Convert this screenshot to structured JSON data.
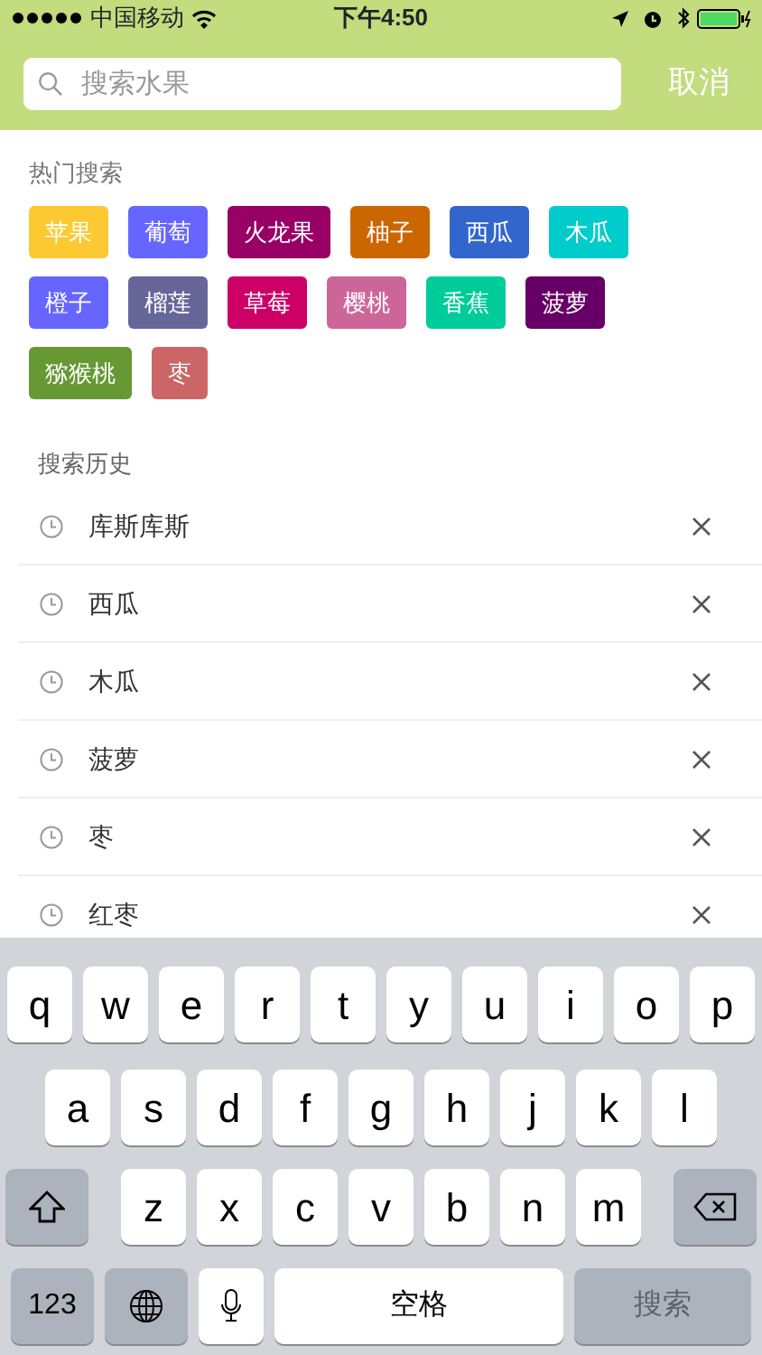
{
  "status_bar": {
    "carrier": "中国移动",
    "time": "下午4:50"
  },
  "search": {
    "placeholder": "搜索水果",
    "cancel": "取消"
  },
  "hot": {
    "title": "热门搜索",
    "tags": [
      {
        "label": "苹果",
        "color": "#fdc932"
      },
      {
        "label": "葡萄",
        "color": "#6666ff"
      },
      {
        "label": "火龙果",
        "color": "#990066"
      },
      {
        "label": "柚子",
        "color": "#cc6600"
      },
      {
        "label": "西瓜",
        "color": "#3366cc"
      },
      {
        "label": "木瓜",
        "color": "#00cccc"
      },
      {
        "label": "橙子",
        "color": "#6666ff"
      },
      {
        "label": "榴莲",
        "color": "#666699"
      },
      {
        "label": "草莓",
        "color": "#cc0066"
      },
      {
        "label": "樱桃",
        "color": "#cc6699"
      },
      {
        "label": "香蕉",
        "color": "#00cc99"
      },
      {
        "label": "菠萝",
        "color": "#660066"
      },
      {
        "label": "猕猴桃",
        "color": "#669933"
      },
      {
        "label": "枣",
        "color": "#cc6666"
      }
    ]
  },
  "history": {
    "title": "搜索历史",
    "items": [
      {
        "label": "库斯库斯"
      },
      {
        "label": "西瓜"
      },
      {
        "label": "木瓜"
      },
      {
        "label": "菠萝"
      },
      {
        "label": "枣"
      },
      {
        "label": "红枣"
      }
    ]
  },
  "keyboard": {
    "rows": [
      [
        "q",
        "w",
        "e",
        "r",
        "t",
        "y",
        "u",
        "i",
        "o",
        "p"
      ],
      [
        "a",
        "s",
        "d",
        "f",
        "g",
        "h",
        "j",
        "k",
        "l"
      ],
      [
        "z",
        "x",
        "c",
        "v",
        "b",
        "n",
        "m"
      ]
    ],
    "numbers_key": "123",
    "space_key": "空格",
    "search_key": {
      "label": "搜索",
      "disabled": true
    }
  }
}
